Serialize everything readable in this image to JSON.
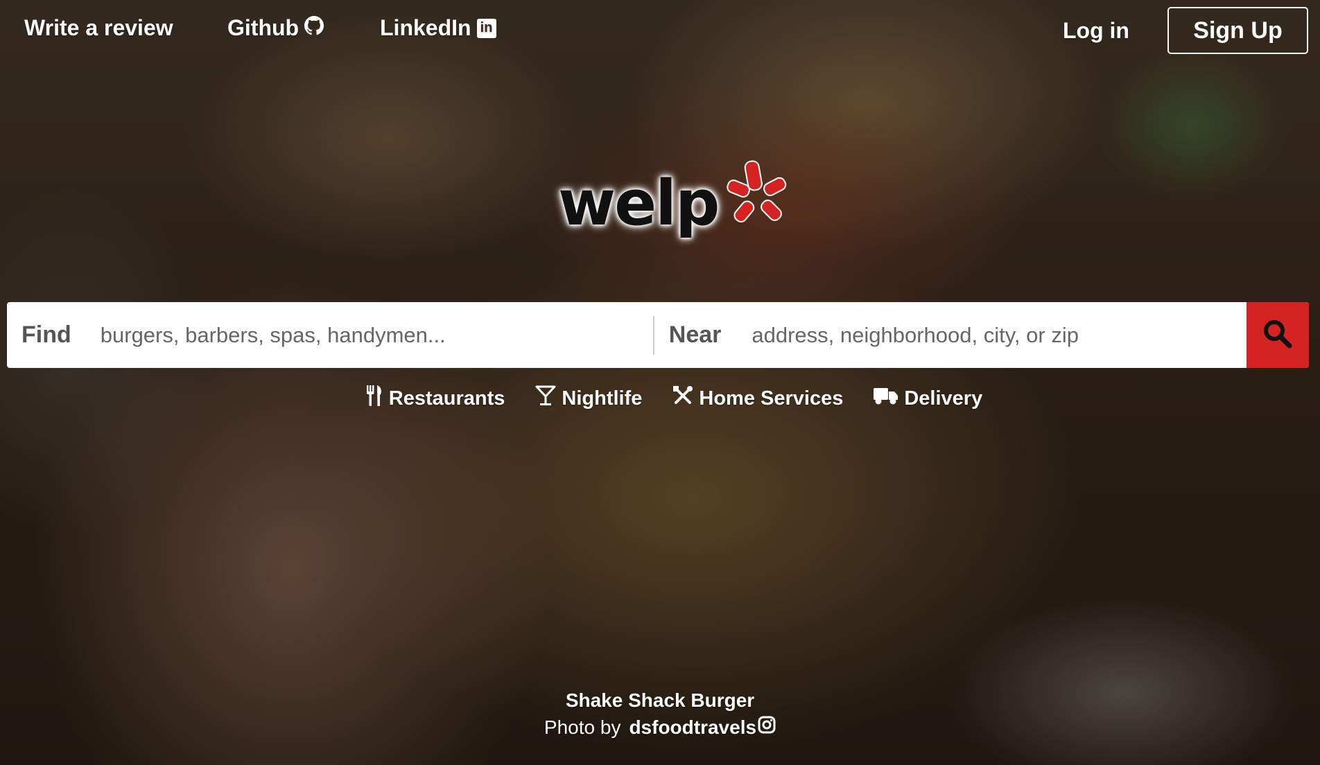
{
  "colors": {
    "brand_red": "#d32323",
    "logo_text": "#111111"
  },
  "nav": {
    "write_review": "Write a review",
    "github": "Github",
    "linkedin": "LinkedIn",
    "login": "Log in",
    "signup": "Sign Up"
  },
  "logo": {
    "word": "welp",
    "icon": "yelp-burst-icon"
  },
  "search": {
    "find_label": "Find",
    "find_placeholder": "burgers, barbers, spas, handymen...",
    "near_label": "Near",
    "near_placeholder": "address, neighborhood, city, or zip",
    "button_icon": "search-icon"
  },
  "categories": [
    {
      "label": "Restaurants",
      "icon": "utensils-icon"
    },
    {
      "label": "Nightlife",
      "icon": "cocktail-icon"
    },
    {
      "label": "Home Services",
      "icon": "tools-icon"
    },
    {
      "label": "Delivery",
      "icon": "truck-icon"
    }
  ],
  "credit": {
    "title": "Shake Shack Burger",
    "photo_by": "Photo by",
    "author": "dsfoodtravels",
    "author_icon": "instagram-icon"
  }
}
